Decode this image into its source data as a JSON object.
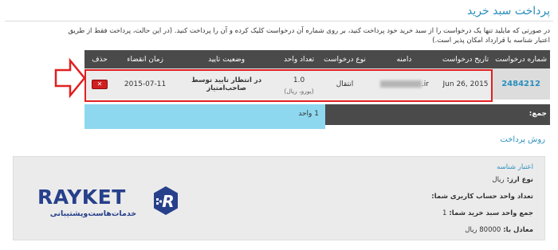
{
  "page": {
    "title": "پرداخت سبد خرید",
    "intro": "در صورتی که مایلید تنها یک درخواست را از سبد خرید خود پرداخت کنید، بر روی شماره آن درخواست کلیک کرده و آن را پرداخت کنید. (در این حالت، پرداخت فقط از طریق اعتبار شناسه یا قرارداد امکان پذیر است.)"
  },
  "table": {
    "headers": {
      "request_number": "شماره درخواست",
      "request_date": "تاریخ درخواست",
      "domain": "دامنه",
      "request_type": "نوع درخواست",
      "unit_count": "تعداد واحد",
      "approval_status": "وضعیت تایید",
      "expiry_date": "زمان انقضاء",
      "delete": "حذف"
    },
    "row": {
      "request_number": "2484212",
      "request_date": "Jun 26, 2015",
      "domain_suffix": ".ir",
      "request_type": "انتقال",
      "unit_count": "1.0",
      "unit_type": "(یورو، ریال)",
      "approval_status": "در انتظار تایید توسط صاحب‌امتیاز",
      "expiry_date": "2015-07-11",
      "delete_label": "✕"
    }
  },
  "total": {
    "label": "جمع:",
    "value": "1 واحد"
  },
  "payment": {
    "section_title": "روش پرداخت",
    "method_title": "اعتبار شناسه",
    "currency_label": "نوع ارز:",
    "currency_value": "ریال",
    "user_units_label": "تعداد واحد حساب کاربری شما:",
    "user_units_value": "",
    "cart_units_label": "جمع واحد سبد خرید شما:",
    "cart_units_value": "1",
    "equivalent_label": "معادل با:",
    "equivalent_value": "80000 ریال"
  },
  "logo": {
    "brand": "RAYKET",
    "tagline": "خدمات‌هاست‌وپشتیبانی",
    "mark_letter": "R"
  },
  "colors": {
    "accent": "#2a8fbd",
    "header_dark": "#4a4a4a",
    "highlight_red": "#e02020",
    "aqua": "#8ed8ef",
    "brand_blue": "#27408b"
  },
  "icons": {
    "delete": "close-icon",
    "annotation": "arrow-right-icon"
  }
}
